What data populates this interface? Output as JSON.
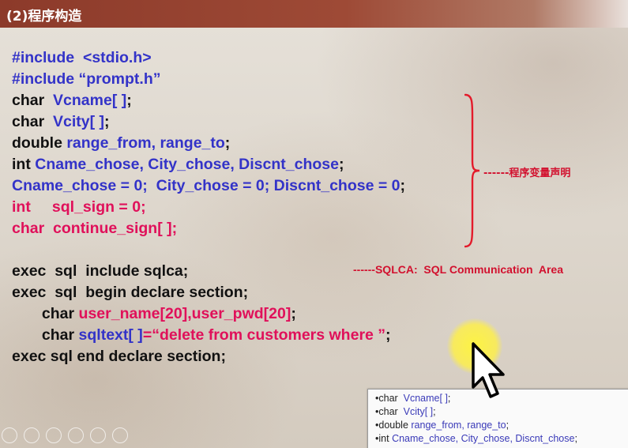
{
  "title": "(2)程序构造",
  "code_lines": [
    [
      {
        "t": "#include  <stdio.h>",
        "c": "b"
      }
    ],
    [
      {
        "t": "#include “prompt.h”",
        "c": "b"
      }
    ],
    [
      {
        "t": "char  ",
        "c": "k"
      },
      {
        "t": "Vcname[ ]",
        "c": "b"
      },
      {
        "t": ";",
        "c": "k"
      }
    ],
    [
      {
        "t": "char  ",
        "c": "k"
      },
      {
        "t": "Vcity[ ]",
        "c": "b"
      },
      {
        "t": ";",
        "c": "k"
      }
    ],
    [
      {
        "t": "double ",
        "c": "k"
      },
      {
        "t": "range_from, range_to",
        "c": "b"
      },
      {
        "t": ";",
        "c": "k"
      }
    ],
    [
      {
        "t": "int ",
        "c": "k"
      },
      {
        "t": "Cname_chose, City_chose, Discnt_chose",
        "c": "b"
      },
      {
        "t": ";",
        "c": "k"
      }
    ],
    [
      {
        "t": "Cname_chose = 0;  City_chose = 0; Discnt_chose = 0",
        "c": "b"
      },
      {
        "t": ";",
        "c": "k"
      }
    ],
    [
      {
        "t": "int     sql_sign = 0;",
        "c": "r"
      }
    ],
    [
      {
        "t": "char  continue_sign[ ];",
        "c": "r"
      }
    ],
    [],
    [
      {
        "t": "exec  sql  include sqlca;",
        "c": "k"
      }
    ],
    [
      {
        "t": "exec  sql  begin declare section;",
        "c": "k"
      }
    ],
    [
      {
        "t": "       char ",
        "c": "k"
      },
      {
        "t": "user_name[20],user_pwd[20]",
        "c": "r"
      },
      {
        "t": ";",
        "c": "k"
      }
    ],
    [
      {
        "t": "       char ",
        "c": "k"
      },
      {
        "t": "sqltext[ ]",
        "c": "b"
      },
      {
        "t": "=“delete from customers where ”",
        "c": "r"
      },
      {
        "t": ";",
        "c": "k"
      }
    ],
    [
      {
        "t": "exec sql end declare section;",
        "c": "k"
      }
    ]
  ],
  "annotations": {
    "declare_note": "------程序变量声明",
    "sqlca_note": "------SQLCA:  SQL Communication  Area"
  },
  "popup_lines": [
    [
      {
        "t": "•char  ",
        "c": "pk"
      },
      {
        "t": "Vcname[ ]",
        "c": "pb"
      },
      {
        "t": ";",
        "c": "pk"
      }
    ],
    [
      {
        "t": "•char  ",
        "c": "pk"
      },
      {
        "t": "Vcity[ ]",
        "c": "pb"
      },
      {
        "t": ";",
        "c": "pk"
      }
    ],
    [
      {
        "t": "•double ",
        "c": "pk"
      },
      {
        "t": "range_from, range_to",
        "c": "pb"
      },
      {
        "t": ";",
        "c": "pk"
      }
    ],
    [
      {
        "t": "•int ",
        "c": "pk"
      },
      {
        "t": "Cname_chose, City_chose, Discnt_chose",
        "c": "pb"
      },
      {
        "t": ";",
        "c": "pk"
      }
    ]
  ],
  "colors": {
    "keyword": "#111111",
    "identifier": "#3333c8",
    "highlight": "#e0105a",
    "annotation": "#d2102e",
    "title_bar": "#8c3a2a"
  },
  "icons": [
    "cursor-arrow-icon",
    "pointer-highlight-icon"
  ]
}
